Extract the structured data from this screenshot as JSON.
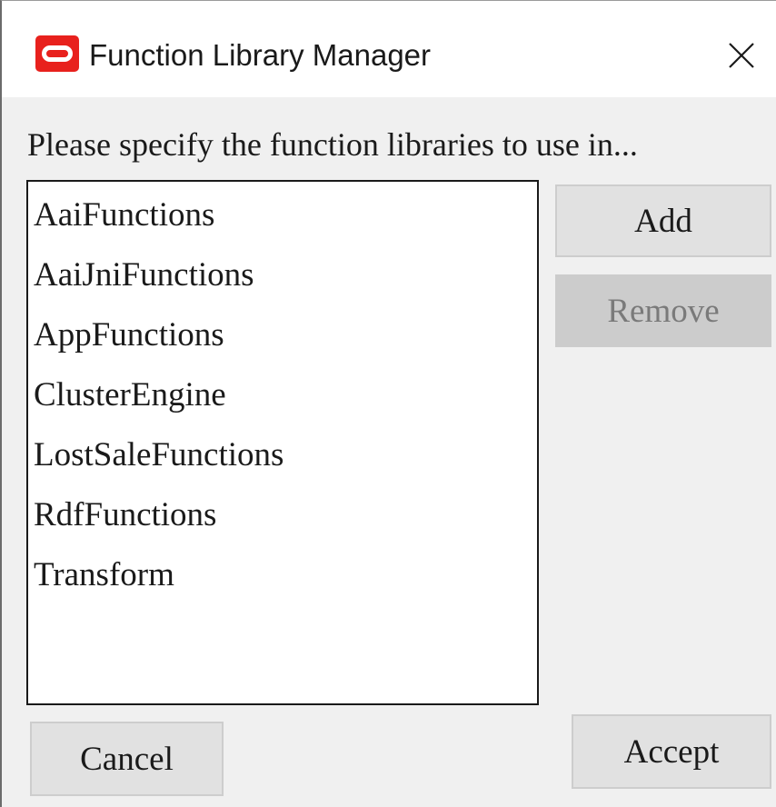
{
  "window": {
    "title": "Function Library Manager",
    "app_icon": "oracle-logo-icon",
    "close_icon": "close-icon"
  },
  "prompt": "Please specify the function libraries to use in...",
  "libraries": [
    "AaiFunctions",
    "AaiJniFunctions",
    "AppFunctions",
    "ClusterEngine",
    "LostSaleFunctions",
    "RdfFunctions",
    "Transform"
  ],
  "buttons": {
    "add": "Add",
    "remove": "Remove",
    "remove_enabled": false,
    "cancel": "Cancel",
    "accept": "Accept"
  },
  "colors": {
    "brand": "#e8211d",
    "dialog_background": "#f0f0f0",
    "button_background": "#e1e1e1",
    "disabled_text": "#7a7a7a"
  }
}
